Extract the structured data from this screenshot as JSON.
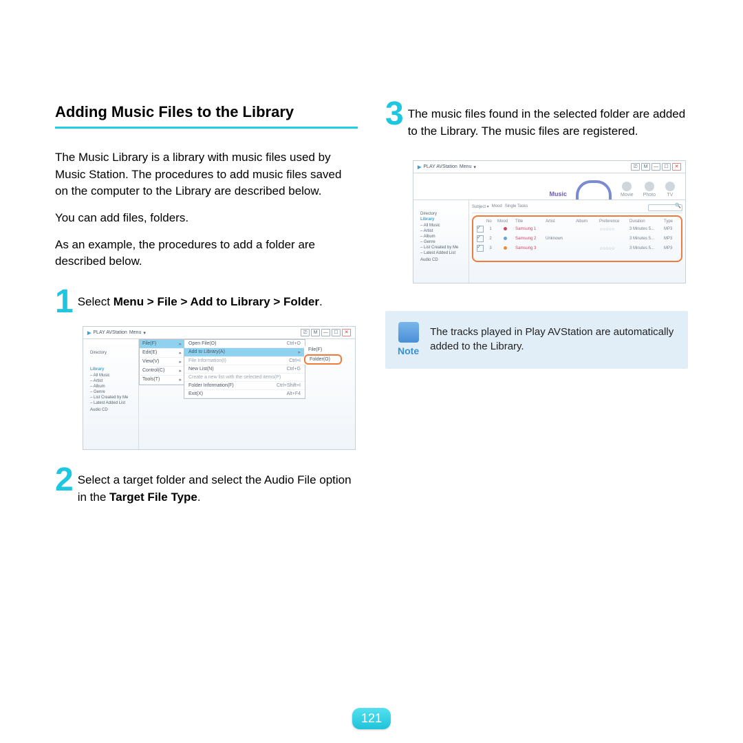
{
  "heading": "Adding Music Files to the Library",
  "intro1": "The Music Library is a library with music files used by Music Station. The procedures to add music files saved on the computer to the Library are described below.",
  "intro2": "You can add files, folders.",
  "intro3": "As an example, the procedures to add a folder are described below.",
  "steps": {
    "s1_num": "1",
    "s1_a": "Select ",
    "s1_b": "Menu > File > Add to Library > Folder",
    "s1_c": ".",
    "s2_num": "2",
    "s2_a": "Select a target folder and select the Audio File option in the ",
    "s2_b": "Target File Type",
    "s2_c": ".",
    "s3_num": "3",
    "s3_text": "The music files found in the selected folder are added to the Library. The music files are registered."
  },
  "note": {
    "label": "Note",
    "text": "The tracks played in Play AVStation are automatically added to the Library."
  },
  "page_number": "121",
  "shot_common": {
    "app": "PLAY AVStation",
    "menu_label": "Menu",
    "dir_label": "Directory",
    "side_hdr": "Library",
    "side_items": [
      "– All Music",
      "– Artist",
      "– Album",
      "– Genre",
      "– List Created by Me",
      "– Latest Added List"
    ],
    "side_audio": "Audio CD"
  },
  "shot1": {
    "menu1": [
      {
        "l": "File(F)",
        "hi": true
      },
      {
        "l": "Edit(E)"
      },
      {
        "l": "View(V)"
      },
      {
        "l": "Control(C)"
      },
      {
        "l": "Tools(T)"
      }
    ],
    "menu2": [
      {
        "l": "Open File(O)",
        "s": "Ctrl+O"
      },
      {
        "l": "Add to Library(A)",
        "hi": true
      },
      {
        "l": "File Information(I)",
        "s": "Ctrl+I",
        "dim": true
      },
      {
        "l": "New List(N)",
        "s": "Ctrl+G"
      },
      {
        "l": "Create a new list with the selected items(P)",
        "dim": true
      },
      {
        "l": "Folder Information(F)",
        "s": "Ctrl+Shift+I"
      },
      {
        "l": "Exit(X)",
        "s": "Alt+F4"
      }
    ],
    "menu3": [
      {
        "l": "File(F)"
      },
      {
        "l": "Folder(O)",
        "callout": true
      }
    ]
  },
  "shot2": {
    "tabs": {
      "music": "Music",
      "movie": "Movie",
      "photo": "Photo",
      "tv": "TV"
    },
    "bar": [
      "Subject ▾",
      "Mood",
      "Single Tasks"
    ],
    "thead": [
      "",
      "No",
      "Mood",
      "Title",
      "Artist",
      "Album",
      "Preference",
      "Duration",
      "Type"
    ],
    "rows": [
      {
        "no": "1",
        "dotc": "#c94a5f",
        "title": "Samsung 1",
        "artist": "",
        "pref": "☆☆☆☆☆",
        "dur": "3 Minutes 5...",
        "type": "MP3"
      },
      {
        "no": "2",
        "dotc": "#6aa0d8",
        "title": "Samsung 2",
        "artist": "Unknown",
        "pref": "",
        "dur": "3 Minutes 5...",
        "type": "MP3"
      },
      {
        "no": "3",
        "dotc": "#e68b39",
        "title": "Samsung 3",
        "artist": "",
        "pref": "☆☆☆☆☆",
        "dur": "3 Minutes 5...",
        "type": "MP3"
      }
    ]
  }
}
